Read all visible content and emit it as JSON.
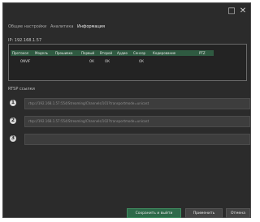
{
  "tabs": [
    "Общие настройки",
    "Аналитика",
    "Информация"
  ],
  "ip_label": "IP: 192.168.1.57",
  "table": {
    "headers": [
      "Протокол",
      "Модель",
      "Прошивка",
      "Первый",
      "Второй",
      "Аудио",
      "Сенсор",
      "Кодирование",
      "PTZ"
    ],
    "row": [
      "ONVIF",
      "",
      "",
      "ОК",
      "ОК",
      "",
      "ОК",
      "",
      ""
    ]
  },
  "rtsp": {
    "label": "RTSP ссылки",
    "links": [
      "rtsp://192.168.1.57:554/Streaming/Channels/101?transportmode=unicast",
      "rtsp://192.168.1.57:554/Streaming/Channels/102?transportmode=unicast",
      ""
    ],
    "icons": [
      "1",
      "2",
      "3"
    ]
  },
  "buttons": {
    "save_exit": "Сохранить и выйти",
    "apply": "Применить",
    "cancel": "Отмена"
  },
  "window_controls": {
    "maximize": "□",
    "close": "✕"
  }
}
